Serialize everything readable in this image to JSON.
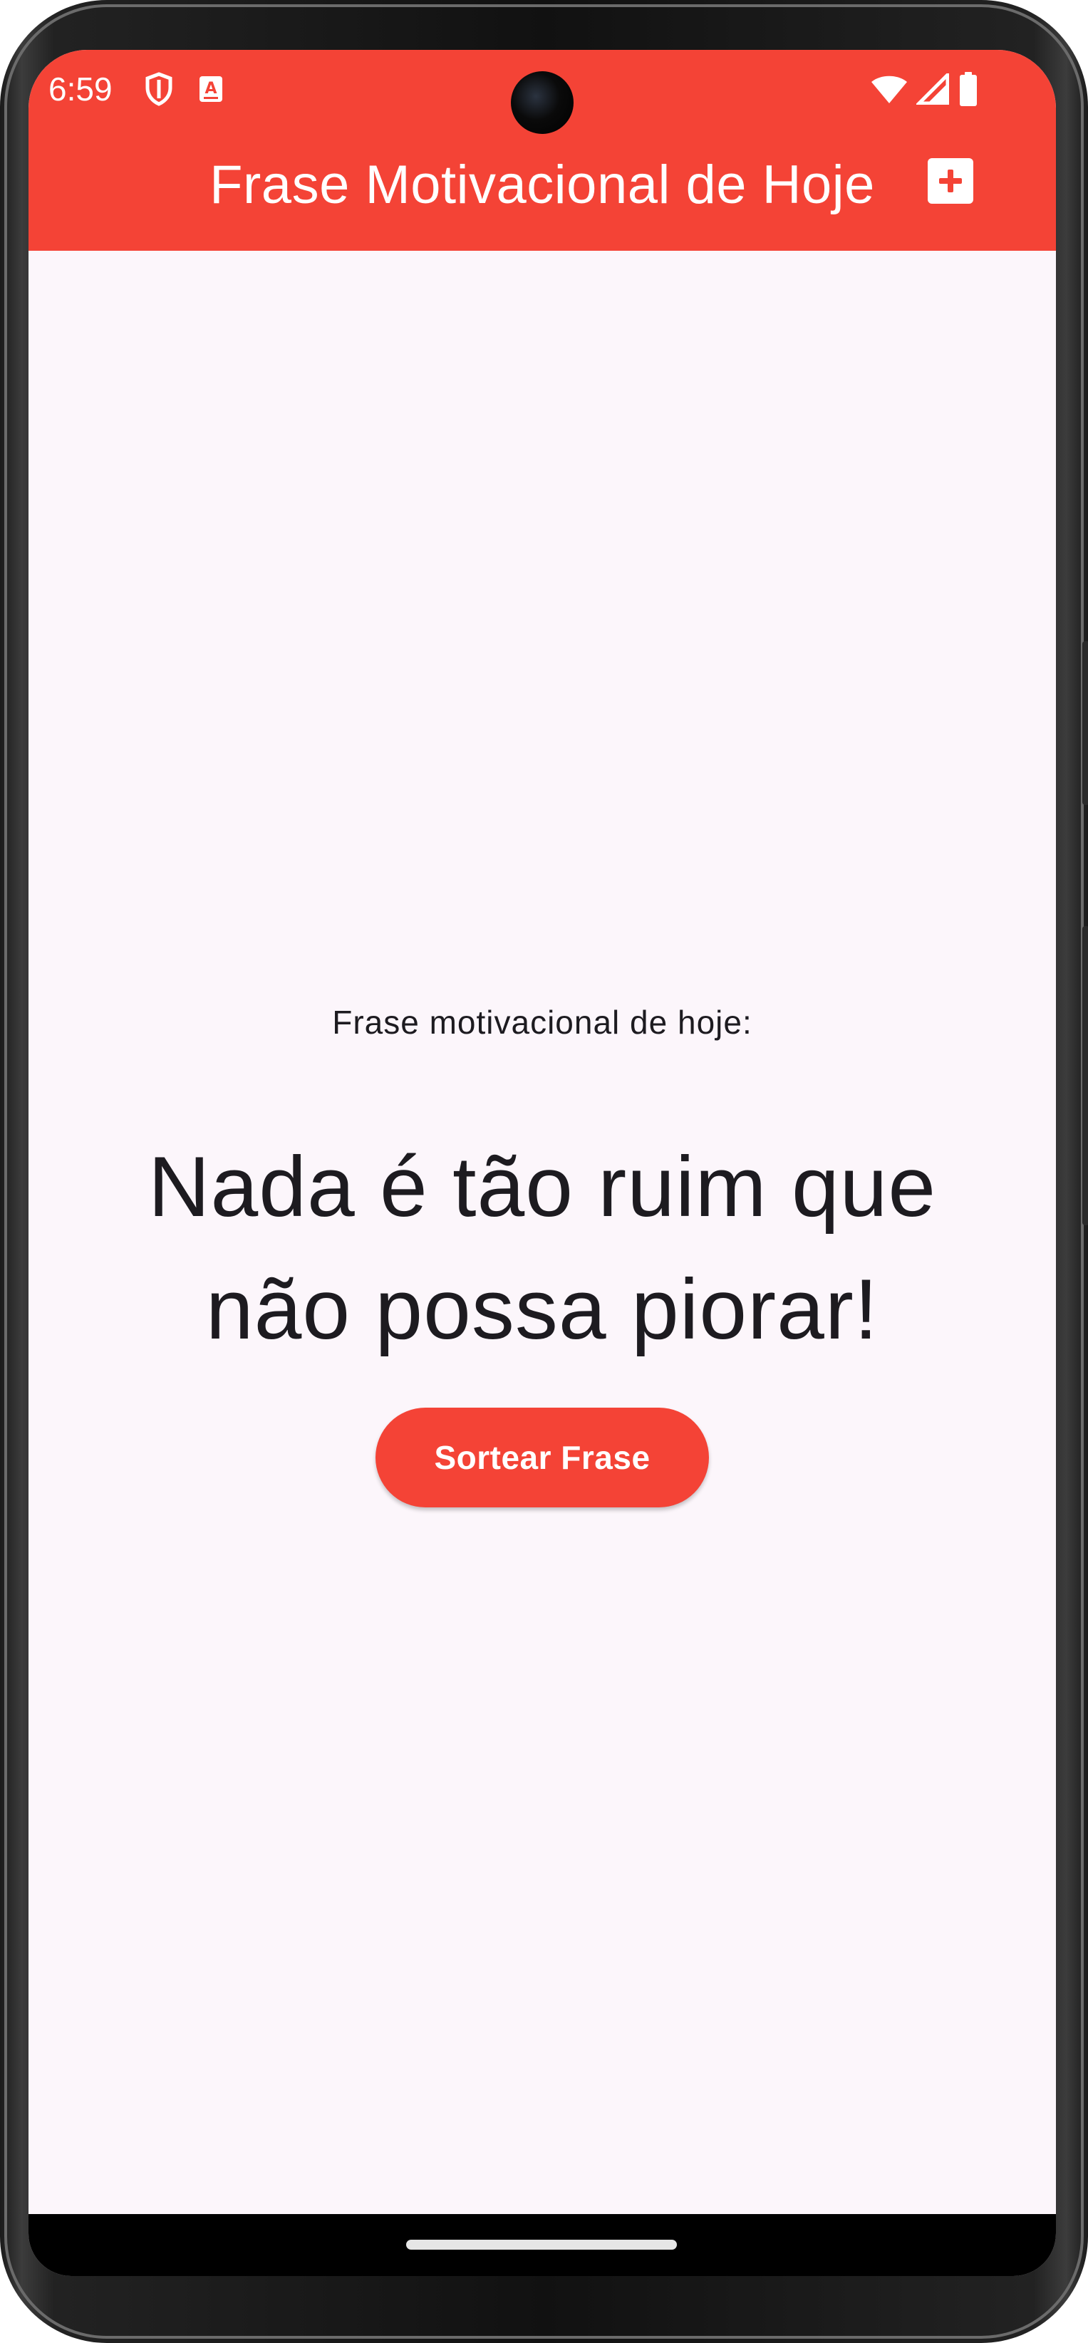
{
  "status_bar": {
    "time": "6:59",
    "icons_left": [
      "shield-icon",
      "a-keyboard-icon"
    ],
    "icons_right": [
      "wifi-icon",
      "signal-icon",
      "battery-icon"
    ]
  },
  "app_bar": {
    "title": "Frase Motivacional de Hoje",
    "action_icon": "add-box-icon",
    "color": "#f44336"
  },
  "main": {
    "subtitle": "Frase motivacional de hoje:",
    "quote": "Nada é tão ruim que não possa piorar!",
    "button_label": "Sortear Frase",
    "background": "#fcf6fb"
  }
}
